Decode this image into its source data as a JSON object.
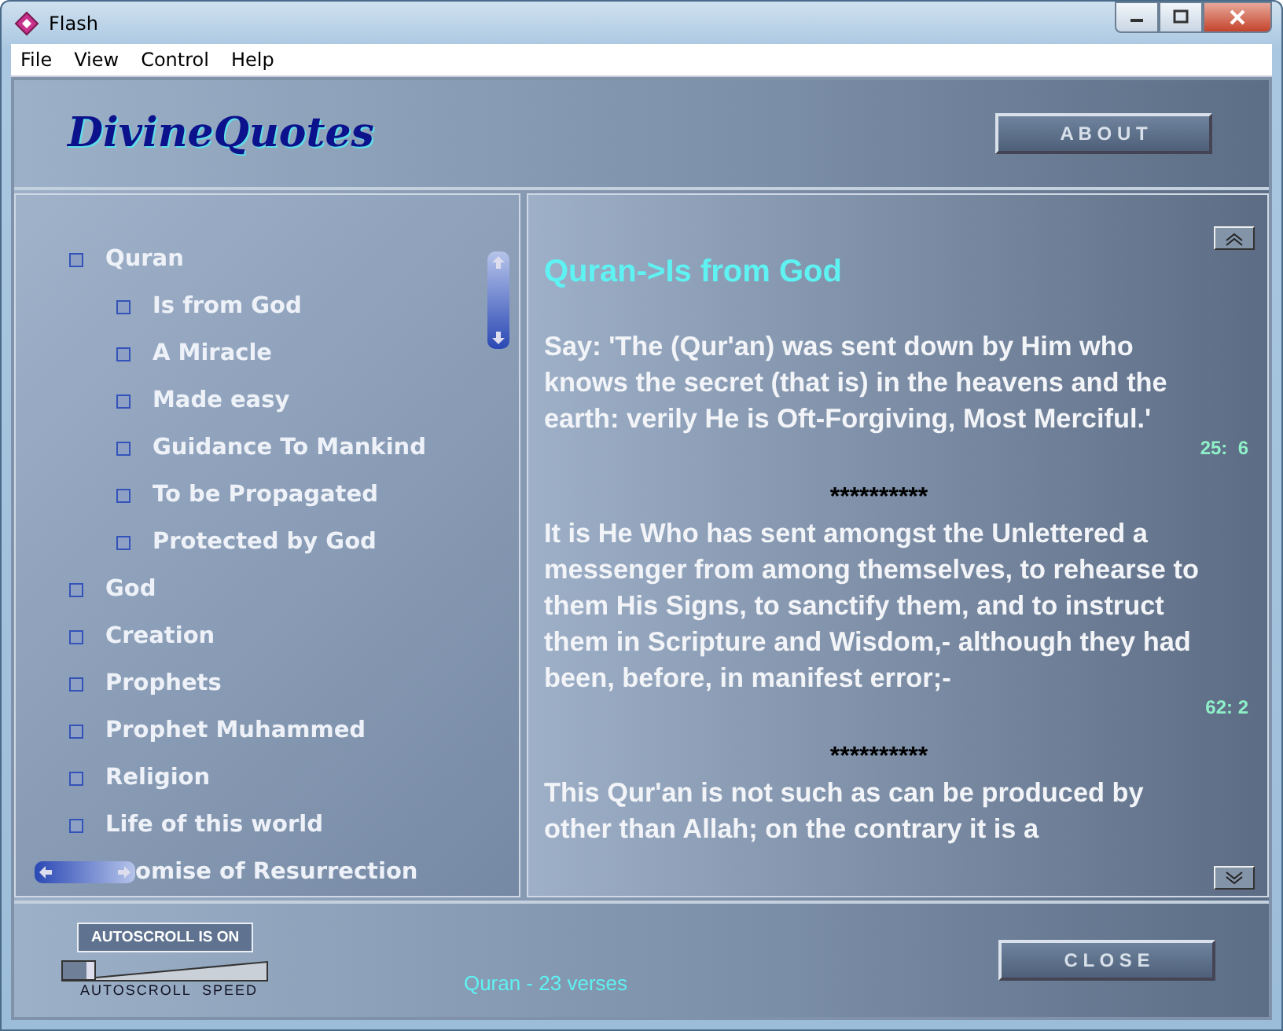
{
  "window": {
    "title": "Flash"
  },
  "menu": [
    "File",
    "View",
    "Control",
    "Help"
  ],
  "header": {
    "logo": "DivineQuotes",
    "about_button": "A B O U T"
  },
  "topics": [
    {
      "label": "Quran",
      "children": [
        {
          "label": "Is from God"
        },
        {
          "label": "A Miracle"
        },
        {
          "label": "Made easy"
        },
        {
          "label": "Guidance To Mankind"
        },
        {
          "label": "To be Propagated"
        },
        {
          "label": "Protected by God"
        }
      ]
    },
    {
      "label": "God"
    },
    {
      "label": "Creation"
    },
    {
      "label": "Prophets"
    },
    {
      "label": "Prophet Muhammed"
    },
    {
      "label": "Religion"
    },
    {
      "label": "Life of this world"
    }
  ],
  "partial_topic": "omise of Resurrection",
  "reader": {
    "heading": "Quran->Is from God",
    "items": [
      {
        "kind": "verse",
        "text": "Say: 'The (Qur'an) was sent down by Him who knows the secret (that is) in the heavens and the earth: verily He is Oft-Forgiving, Most Merciful.'",
        "reference": "25:  6"
      },
      {
        "kind": "separator",
        "text": "**********"
      },
      {
        "kind": "verse",
        "text": "It is He Who has sent amongst the Unlettered a messenger from among themselves, to rehearse to them His Signs, to sanctify them, and to instruct them in Scripture and Wisdom,- although they had been, before, in manifest error;-",
        "reference": "62: 2"
      },
      {
        "kind": "separator",
        "text": "**********"
      },
      {
        "kind": "verse",
        "text": "This Qur'an is not such as can be produced by other than Allah; on the contrary it is a"
      }
    ]
  },
  "footer": {
    "autoscroll_button": "AUTOSCROLL IS ON",
    "speed": {
      "label": "AUTOSCROLL  SPEED",
      "level": 0.17
    },
    "status": "Quran - 23 verses",
    "close_button": "C L O S E"
  }
}
